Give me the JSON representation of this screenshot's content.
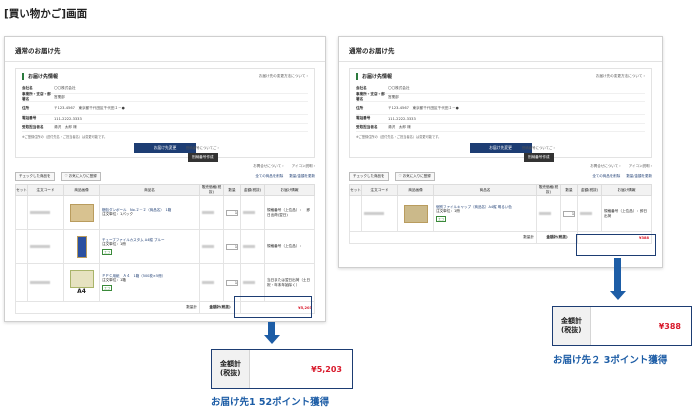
{
  "page_title": "[買い物かご]画面",
  "screen1": {
    "header": "通常のお届け先",
    "panel_title": "お届け先情報",
    "panel_link": "お届け先の変更方法について ›",
    "info_rows": [
      {
        "k": "会社名",
        "v": "〇〇株式会社"
      },
      {
        "k": "事業所・支店・部署名",
        "v": "営業部"
      },
      {
        "k": "住所",
        "v": "〒123-4567　東京都千代田区千代田１－●"
      },
      {
        "k": "電話番号",
        "v": "111-2222-3333"
      },
      {
        "k": "受取担当者名",
        "v": "湯沢　太郎 様"
      }
    ],
    "note": "※ご登録住所の（送付先名・ご担当者名）は変更可能です。",
    "side_note": "別納番号についてご ›",
    "black_btn": "別納番号作成",
    "blue_btn": "お届け先変更",
    "links": [
      "お問合せについて ›",
      "アイコン説明 ›"
    ],
    "check_btn": "チェックした商品を",
    "fav_btn": "♡ お気に入りに登録",
    "right_links": [
      "全ての商品を削除",
      "数量/金額を更新"
    ],
    "table_headers": [
      "セット",
      "注文コード",
      "商品画像",
      "商品名",
      "販売価格(税抜)",
      "数量",
      "金額(税抜)",
      "お届け情報"
    ],
    "products": [
      {
        "name": "梱包ダンボール　No.２－２（商品名）　1箱",
        "spec": "注文単位：1パック",
        "qty": "1",
        "info": "規格番号（上位品）：　即日出荷(翌日)",
        "img": "box"
      },
      {
        "name": "チューブファイルカスタム A4縦 ブルー",
        "spec": "注文単位：1冊",
        "qty": "1",
        "info": "規格番号（上位品）：",
        "img": "blue",
        "eco": "エコ"
      },
      {
        "name": "ＰＰＣ用紙　Ａ４　1箱（500枚×5冊）",
        "spec": "注文単位：1箱",
        "qty": "1",
        "info": "当日または翌日出荷（土日祝・年末年始除く）",
        "img": "green",
        "eco": "エコ",
        "label": "A4"
      }
    ],
    "subtotal_label": "数量計",
    "total_label": "金額計(税抜)",
    "total_value": "¥5,203"
  },
  "screen2": {
    "header": "通常のお届け先",
    "panel_title": "お届け先情報",
    "panel_link": "お届け先の変更方法について ›",
    "info_rows": [
      {
        "k": "会社名",
        "v": "〇〇株式会社"
      },
      {
        "k": "事業所・支店・部署名",
        "v": "営業部"
      },
      {
        "k": "住所",
        "v": "〒123-4567　東京都千代田区千代田１－●"
      },
      {
        "k": "電話番号",
        "v": "111-2222-3333"
      },
      {
        "k": "受取担当者名",
        "v": "湯沢　太郎 様"
      }
    ],
    "note": "※ご登録住所の（送付先名・ご担当者名）は変更可能です。",
    "side_note": "別納番号についてご ›",
    "black_btn": "別納番号作成",
    "blue_btn": "お届け先変更",
    "links": [
      "お問合せについて ›",
      "アイコン説明 ›"
    ],
    "check_btn": "チェックした商品を",
    "fav_btn": "♡ お気に入りに登録",
    "right_links": [
      "全ての商品を削除",
      "数量/金額を更新"
    ],
    "table_headers": [
      "セット",
      "注文コード",
      "商品画像",
      "商品名",
      "販売価格(税抜)",
      "数量",
      "金額(税抜)",
      "お届け情報"
    ],
    "products": [
      {
        "name": "個別ファイルキャップ（商品名）A4縦 明るい色",
        "spec": "注文単位：1冊",
        "qty": "1",
        "info": "規格番号（上位品）：即日出荷",
        "img": "box",
        "eco": "エコ"
      }
    ],
    "subtotal_label": "数量計",
    "total_label": "金額計(税抜)",
    "total_value": "¥388"
  },
  "zoom1": {
    "label_line1": "金額計",
    "label_line2": "(税抜)",
    "value": "¥5,203",
    "caption": "お届け先1  52ポイント獲得"
  },
  "zoom2": {
    "label_line1": "金額計",
    "label_line2": "(税抜)",
    "value": "¥388",
    "caption": "お届け先２  3ポイント獲得"
  },
  "colors": {
    "accent": "#1d5da6",
    "price": "#d8182a",
    "navy": "#1d3d73"
  }
}
